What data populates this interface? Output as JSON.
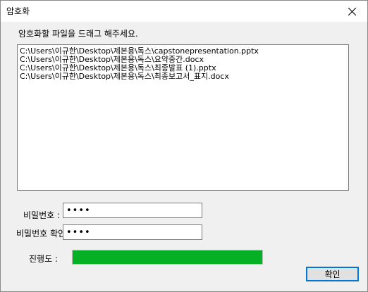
{
  "window": {
    "title": "암호화",
    "close_icon": "close-icon"
  },
  "instruction": "암호화할 파일을 드래그 해주세요.",
  "files": [
    "C:\\Users\\이규한\\Desktop\\제본용\\독스\\capstonepresentation.pptx",
    "C:\\Users\\이규한\\Desktop\\제본용\\독스\\요약중간.docx",
    "C:\\Users\\이규한\\Desktop\\제본용\\독스\\최종발표 (1).pptx",
    "C:\\Users\\이규한\\Desktop\\제본용\\독스\\최종보고서_표지.docx"
  ],
  "password": {
    "label": "비밀번호 :",
    "value": "••••"
  },
  "password_confirm": {
    "label": "비밀번호 확인 :",
    "value": "••••"
  },
  "progress": {
    "label": "진행도 :",
    "percent": 100,
    "color": "#06b025"
  },
  "confirm_button": {
    "label": "확인"
  }
}
